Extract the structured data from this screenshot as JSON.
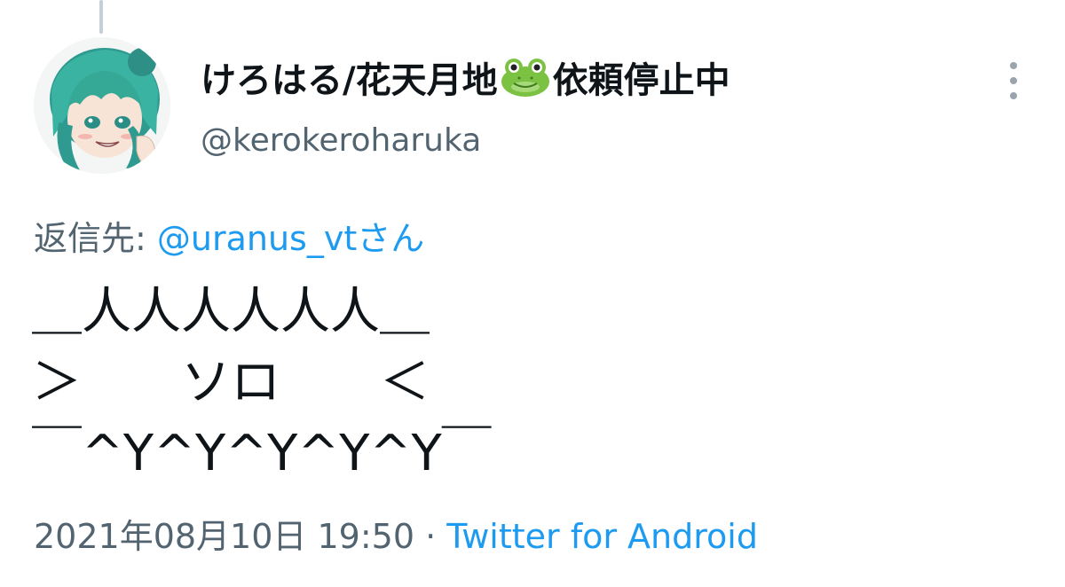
{
  "tweet": {
    "display_name": "けろはる/花天月地",
    "display_name_suffix": "依頼停止中",
    "emoji": "frog-face-emoji",
    "handle": "@kerokeroharuka",
    "reply_prefix": "返信先: ",
    "reply_mention": "@uranus_vtさん",
    "text": "＿人人人人人人＿\n＞　　ソロ　　＜\n￣^Y^Y^Y^Y^Y￣",
    "timestamp": "2021年08月10日 19:50",
    "separator": " · ",
    "source": "Twitter for Android"
  },
  "icons": {
    "more": "more-vertical-icon",
    "avatar": "user-avatar"
  },
  "colors": {
    "text_primary": "#0f1419",
    "text_secondary": "#536471",
    "link": "#1d9bf0",
    "frog_green": "#7cc242"
  }
}
